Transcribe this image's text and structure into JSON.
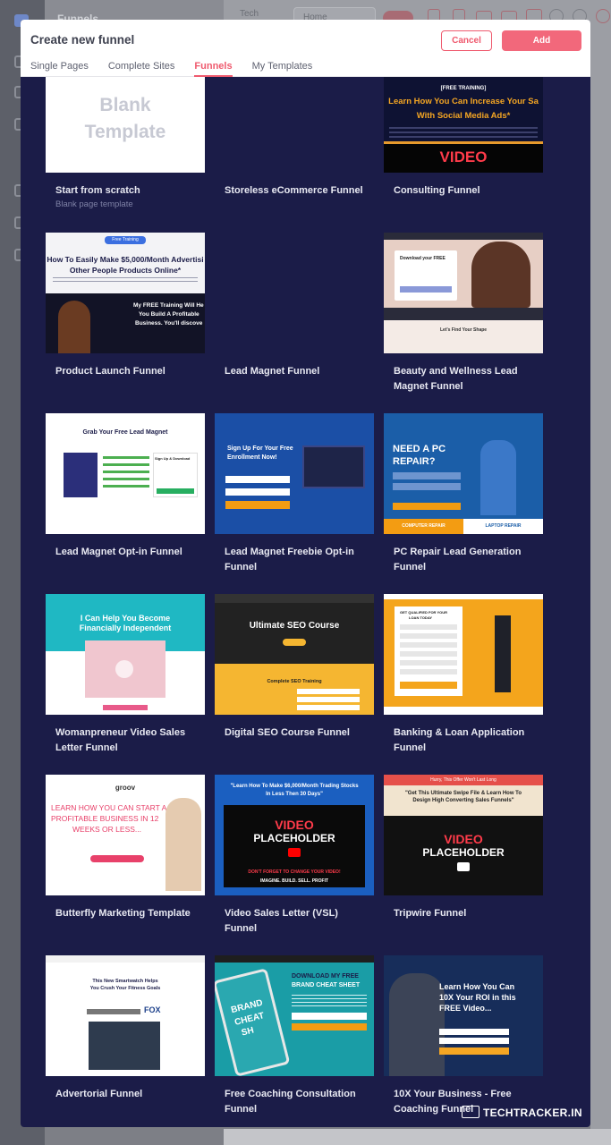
{
  "background": {
    "app_title": "Funnels",
    "top_label": "Tech",
    "page_select": "Home"
  },
  "modal": {
    "title": "Create new funnel",
    "cancel_label": "Cancel",
    "add_label": "Add",
    "tabs": [
      {
        "label": "Single Pages",
        "active": false
      },
      {
        "label": "Complete Sites",
        "active": false
      },
      {
        "label": "Funnels",
        "active": true
      },
      {
        "label": "My Templates",
        "active": false
      }
    ]
  },
  "templates": [
    {
      "title": "Start from scratch",
      "subtitle": "Blank page template",
      "thumb_text": [
        "Blank",
        "Template"
      ]
    },
    {
      "title": "Storeless eCommerce Funnel"
    },
    {
      "title": "Consulting Funnel",
      "thumb_text": [
        "[FREE TRAINING]",
        "Learn How You Can Increase Your Sa",
        "With Social Media Ads*",
        "VIDEO"
      ]
    },
    {
      "title": "Product Launch Funnel",
      "thumb_text": [
        "Free Training",
        "How To Easily Make $5,000/Month Advertisi",
        "Other People Products Online*",
        "My FREE Training Will He",
        "You Build A Profitable",
        "Business. You'll discove"
      ]
    },
    {
      "title": "Lead Magnet Funnel"
    },
    {
      "title": "Beauty and Wellness Lead Magnet Funnel",
      "thumb_text": [
        "Download your FREE",
        "Let's Find Your Shape"
      ]
    },
    {
      "title": "Lead Magnet Opt-in Funnel",
      "thumb_text": [
        "Grab Your Free Lead Magnet",
        "Sign Up & Download"
      ]
    },
    {
      "title": "Lead Magnet Freebie Opt-in Funnel",
      "thumb_text": [
        "Sign Up For Your Free",
        "Enrollment Now!"
      ]
    },
    {
      "title": "PC Repair Lead Generation Funnel",
      "thumb_text": [
        "NEED A PC",
        "REPAIR?",
        "COMPUTER REPAIR",
        "LAPTOP REPAIR"
      ]
    },
    {
      "title": "Womanpreneur Video Sales Letter Funnel",
      "thumb_text": [
        "I Can Help You Become",
        "Financially Independent"
      ]
    },
    {
      "title": "Digital SEO Course Funnel",
      "thumb_text": [
        "Ultimate SEO Course",
        "Complete SEO Training"
      ]
    },
    {
      "title": "Banking & Loan Application Funnel",
      "thumb_text": [
        "GET QUALIFIED FOR YOUR",
        "LOAN TODAY"
      ]
    },
    {
      "title": "Butterfly Marketing Template",
      "thumb_text": [
        "groov",
        "LEARN HOW YOU CAN START A",
        "PROFITABLE BUSINESS IN 12",
        "WEEKS OR LESS..."
      ]
    },
    {
      "title": "Video Sales Letter (VSL) Funnel",
      "thumb_text": [
        "\"Learn How To Make $6,000/Month Trading Stocks",
        "In Less Then 30 Days\"",
        "VIDEO",
        "PLACEHOLDER",
        "DON'T FORGET TO CHANGE YOUR VIDEO!",
        "IMAGINE. BUILD. SELL. PROFIT"
      ]
    },
    {
      "title": "Tripwire Funnel",
      "thumb_text": [
        "Hurry, This Offer Won't Last Long",
        "\"Get This Ultimate Swipe File & Learn How To",
        "Design High Converting Sales Funnels\"",
        "VIDEO",
        "PLACEHOLDER"
      ]
    },
    {
      "title": "Advertorial Funnel",
      "thumb_text": [
        "This New Smartwatch Helps",
        "You Crush Your Fitness Goals",
        "FOX"
      ]
    },
    {
      "title": "Free Coaching Consultation Funnel",
      "thumb_text": [
        "DOWNLOAD MY FREE",
        "BRAND CHEAT SHEET",
        "BRAND",
        "CHEAT",
        "SH"
      ]
    },
    {
      "title": "10X Your Business - Free Coaching Funnel",
      "thumb_text": [
        "Learn How You Can",
        "10X Your ROI in this",
        "FREE Video..."
      ]
    }
  ],
  "watermark": "TECHTRACKER.IN",
  "colors": {
    "accent": "#ef5a6e",
    "modal_bg": "#1b1c48",
    "card_title": "#e8e9f2"
  }
}
